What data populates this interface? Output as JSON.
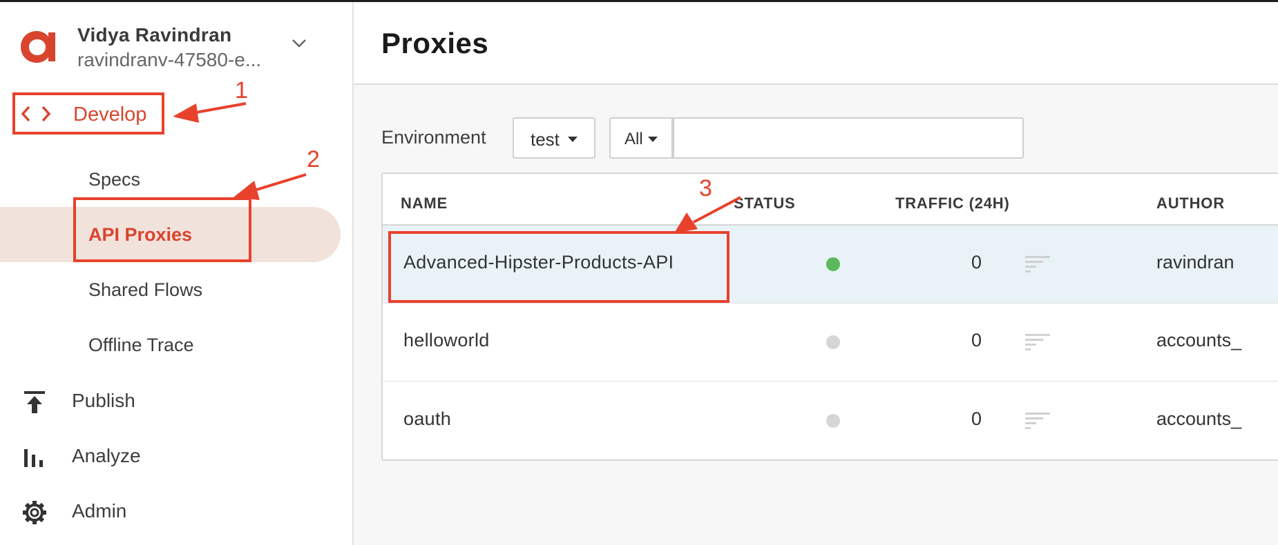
{
  "user": {
    "name": "Vidya Ravindran",
    "org": "ravindranv-47580-e..."
  },
  "nav": {
    "develop": "Develop",
    "sub_items": [
      "Specs",
      "API Proxies",
      "Shared Flows",
      "Offline Trace"
    ],
    "publish": "Publish",
    "analyze": "Analyze",
    "admin": "Admin"
  },
  "page": {
    "title": "Proxies"
  },
  "filters": {
    "environment_label": "Environment",
    "environment_value": "test",
    "type_value": "All",
    "search_value": ""
  },
  "table": {
    "headers": [
      "NAME",
      "STATUS",
      "TRAFFIC (24H)",
      "AUTHOR"
    ],
    "rows": [
      {
        "name": "Advanced-Hipster-Products-API",
        "status": "deployed",
        "traffic": "0",
        "author": "ravindran"
      },
      {
        "name": "helloworld",
        "status": "not deployed",
        "traffic": "0",
        "author": "accounts_"
      },
      {
        "name": "oauth",
        "status": "not deployed",
        "traffic": "0",
        "author": "accounts_"
      }
    ]
  },
  "annotations": [
    "1",
    "2",
    "3"
  ],
  "colors": {
    "accent": "#d9442e",
    "annotation": "#e8412c",
    "status_deployed": "#5cb85c",
    "status_undeployed": "#d6d6d6",
    "active_bg": "#f2e2dc",
    "selected_row": "#e9f3f7"
  },
  "icons": {
    "logo": "apigee-logo",
    "develop": "code-brackets-icon",
    "publish": "upload-icon",
    "analyze": "bar-chart-icon",
    "admin": "gear-icon"
  }
}
